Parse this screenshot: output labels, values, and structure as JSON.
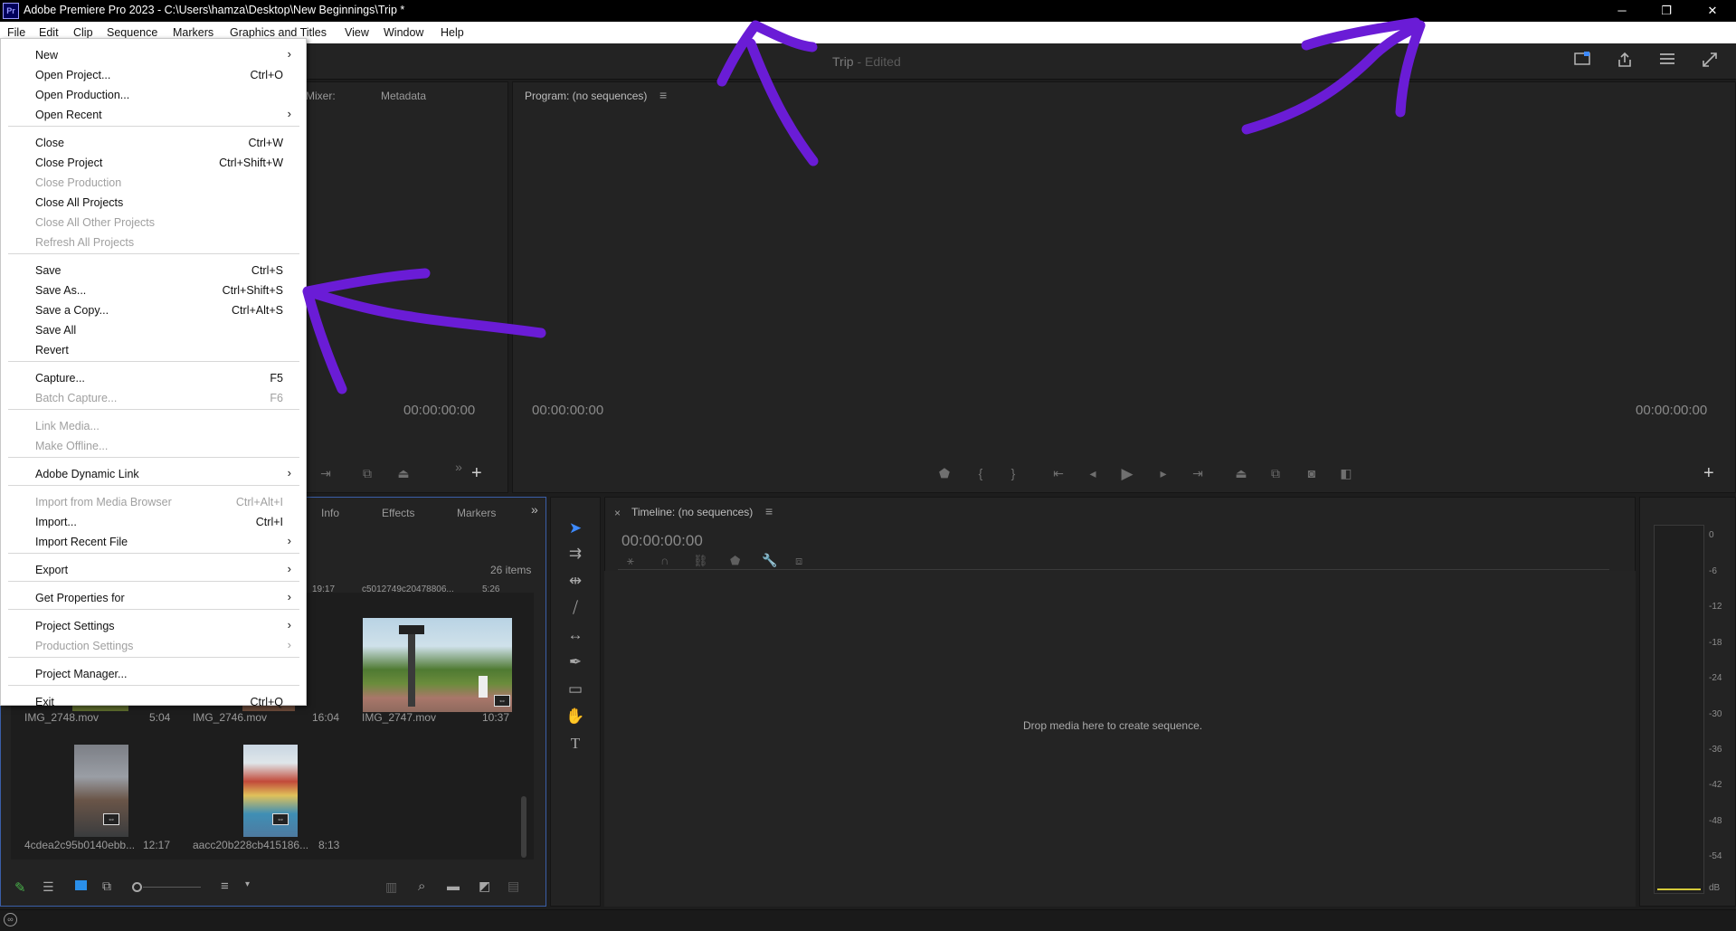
{
  "titlebar": {
    "app_icon": "Pr",
    "title": "Adobe Premiere Pro 2023 - C:\\Users\\hamza\\Desktop\\New Beginnings\\Trip *",
    "controls": {
      "minimize": "─",
      "restore": "❐",
      "close": "✕"
    }
  },
  "menubar": [
    "File",
    "Edit",
    "Clip",
    "Sequence",
    "Markers",
    "Graphics and Titles",
    "View",
    "Window",
    "Help"
  ],
  "header": {
    "project": "Trip",
    "status": "- Edited"
  },
  "file_menu": {
    "items": [
      {
        "label": "New",
        "shortcut": "",
        "submenu": true,
        "disabled": false
      },
      {
        "label": "Open Project...",
        "shortcut": "Ctrl+O",
        "submenu": false,
        "disabled": false
      },
      {
        "label": "Open Production...",
        "shortcut": "",
        "submenu": false,
        "disabled": false
      },
      {
        "label": "Open Recent",
        "shortcut": "",
        "submenu": true,
        "disabled": false
      },
      {
        "label": "Close",
        "shortcut": "Ctrl+W",
        "submenu": false,
        "disabled": false
      },
      {
        "label": "Close Project",
        "shortcut": "Ctrl+Shift+W",
        "submenu": false,
        "disabled": false
      },
      {
        "label": "Close Production",
        "shortcut": "",
        "submenu": false,
        "disabled": true
      },
      {
        "label": "Close All Projects",
        "shortcut": "",
        "submenu": false,
        "disabled": false
      },
      {
        "label": "Close All Other Projects",
        "shortcut": "",
        "submenu": false,
        "disabled": true
      },
      {
        "label": "Refresh All Projects",
        "shortcut": "",
        "submenu": false,
        "disabled": true
      },
      {
        "label": "Save",
        "shortcut": "Ctrl+S",
        "submenu": false,
        "disabled": false
      },
      {
        "label": "Save As...",
        "shortcut": "Ctrl+Shift+S",
        "submenu": false,
        "disabled": false
      },
      {
        "label": "Save a Copy...",
        "shortcut": "Ctrl+Alt+S",
        "submenu": false,
        "disabled": false
      },
      {
        "label": "Save All",
        "shortcut": "",
        "submenu": false,
        "disabled": false
      },
      {
        "label": "Revert",
        "shortcut": "",
        "submenu": false,
        "disabled": false
      },
      {
        "label": "Capture...",
        "shortcut": "F5",
        "submenu": false,
        "disabled": false
      },
      {
        "label": "Batch Capture...",
        "shortcut": "F6",
        "submenu": false,
        "disabled": true
      },
      {
        "label": "Link Media...",
        "shortcut": "",
        "submenu": false,
        "disabled": true
      },
      {
        "label": "Make Offline...",
        "shortcut": "",
        "submenu": false,
        "disabled": true
      },
      {
        "label": "Adobe Dynamic Link",
        "shortcut": "",
        "submenu": true,
        "disabled": false
      },
      {
        "label": "Import from Media Browser",
        "shortcut": "Ctrl+Alt+I",
        "submenu": false,
        "disabled": true
      },
      {
        "label": "Import...",
        "shortcut": "Ctrl+I",
        "submenu": false,
        "disabled": false
      },
      {
        "label": "Import Recent File",
        "shortcut": "",
        "submenu": true,
        "disabled": false
      },
      {
        "label": "Export",
        "shortcut": "",
        "submenu": true,
        "disabled": false
      },
      {
        "label": "Get Properties for",
        "shortcut": "",
        "submenu": true,
        "disabled": false
      },
      {
        "label": "Project Settings",
        "shortcut": "",
        "submenu": true,
        "disabled": false
      },
      {
        "label": "Production Settings",
        "shortcut": "",
        "submenu": true,
        "disabled": true
      },
      {
        "label": "Project Manager...",
        "shortcut": "",
        "submenu": false,
        "disabled": false
      },
      {
        "label": "Exit",
        "shortcut": "Ctrl+Q",
        "submenu": false,
        "disabled": false
      }
    ]
  },
  "source_panel": {
    "tabs": [
      "Mixer:",
      "Metadata"
    ],
    "timecode": "00:00:00:00"
  },
  "program_panel": {
    "title": "Program: (no sequences)",
    "timecode_left": "00:00:00:00",
    "timecode_right": "00:00:00:00"
  },
  "project_panel": {
    "tabs": [
      "Info",
      "Effects",
      "Markers"
    ],
    "item_count": "26 items",
    "clips": [
      {
        "name": "IMG_2748.mov",
        "duration": "5:04"
      },
      {
        "name": "IMG_2746.mov",
        "duration": "16:04"
      },
      {
        "name": "IMG_2747.mov",
        "duration": "10:37"
      },
      {
        "name": "4cdea2c95b0140ebb...",
        "duration": "12:17"
      },
      {
        "name": "aacc20b228cb415186...",
        "duration": "8:13"
      }
    ],
    "partial_top": {
      "a": "19:17",
      "b": "c5012749c20478806...",
      "c": "5:26"
    }
  },
  "timeline": {
    "close": "×",
    "title": "Timeline: (no sequences)",
    "timecode": "00:00:00:00",
    "drop_text": "Drop media here to create sequence."
  },
  "meter": {
    "labels": [
      "0",
      "-6",
      "-12",
      "-18",
      "-24",
      "-30",
      "-36",
      "-42",
      "-48",
      "-54",
      "dB"
    ]
  },
  "annotation_color": "#6a1cd6"
}
